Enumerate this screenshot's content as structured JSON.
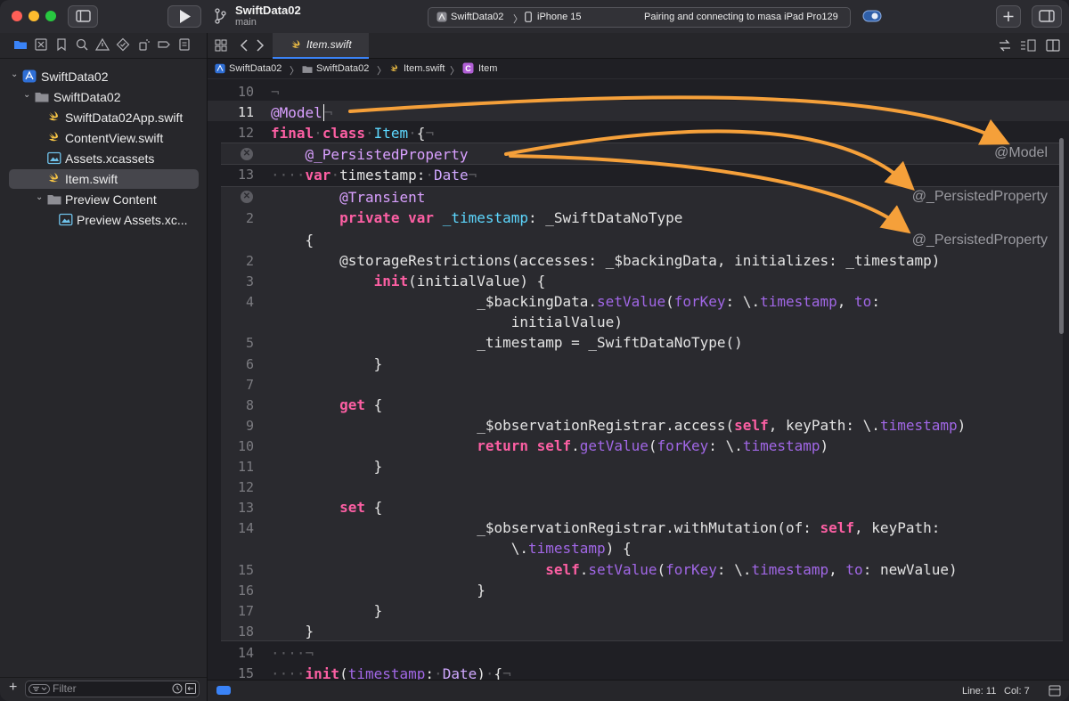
{
  "toolbar": {
    "project_name": "SwiftData02",
    "branch": "main",
    "scheme": "SwiftData02",
    "device": "iPhone 15",
    "status_message": "Pairing and connecting to masa iPad Pro129"
  },
  "navigator": {
    "items": [
      {
        "label": "SwiftData02"
      },
      {
        "label": "SwiftData02"
      },
      {
        "label": "SwiftData02App.swift"
      },
      {
        "label": "ContentView.swift"
      },
      {
        "label": "Assets.xcassets"
      },
      {
        "label": "Item.swift"
      },
      {
        "label": "Preview Content"
      },
      {
        "label": "Preview Assets.xc..."
      }
    ],
    "filter_placeholder": "Filter"
  },
  "editor": {
    "tab_label": "Item.swift",
    "breadcrumbs": [
      "SwiftData02",
      "SwiftData02",
      "Item.swift",
      "Item"
    ],
    "annotations": [
      "@Model",
      "@_PersistedProperty",
      "@_PersistedProperty"
    ],
    "line_numbers": {
      "main_top": [
        "10",
        "11",
        "12"
      ],
      "main_mid": [
        "13"
      ],
      "transient": [
        "2"
      ],
      "expansion": [
        "2",
        "3",
        "4",
        "5",
        "6",
        "7",
        "8",
        "9",
        "10",
        "11",
        "12",
        "13",
        "14",
        "15",
        "16",
        "17",
        "18"
      ],
      "main_bottom": [
        "14",
        "15"
      ]
    }
  },
  "status": {
    "line": "Line: 11",
    "col": "Col: 7"
  },
  "colors": {
    "accent": "#3a83f7",
    "arrow": "#f5a03a",
    "keyword": "#fc5fa3",
    "type": "#5dd8ff"
  }
}
